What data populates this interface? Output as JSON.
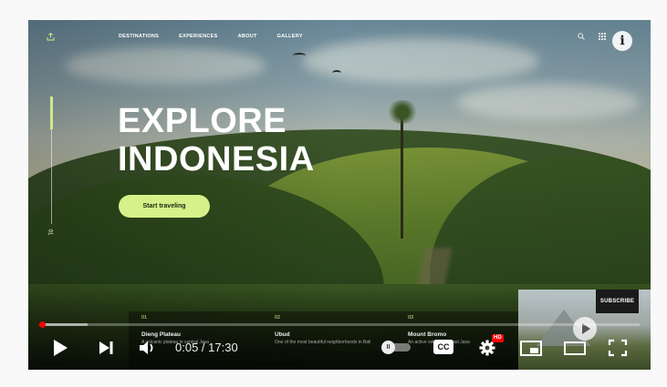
{
  "site": {
    "nav": [
      "DESTINATIONS",
      "EXPERIENCES",
      "ABOUT",
      "GALLERY"
    ],
    "hero_line1": "EXPLORE",
    "hero_line2": "INDONESIA",
    "cta_label": "Start traveling",
    "rail_number": "01",
    "cards": [
      {
        "num": "01",
        "title": "Dieng Plateau",
        "desc": "A volcanic plateau in central Java"
      },
      {
        "num": "02",
        "title": "Ubud",
        "desc": "One of the most beautiful neighborhoods in Bali"
      },
      {
        "num": "03",
        "title": "Mount Bromo",
        "desc": "An active volcano in East Java"
      }
    ]
  },
  "player": {
    "info_glyph": "i",
    "subscribe_label": "SUBSCRIBE",
    "time_display": "0:05 / 17:30",
    "cc_label": "CC",
    "hd_badge": "HD",
    "autoplay_glyph": "II",
    "progress_played_fraction": 0.005,
    "progress_loaded_fraction": 0.08,
    "accent_color": "#ff0000",
    "icons": [
      "upload-icon",
      "search-icon",
      "grid-icon",
      "info-icon",
      "play-icon",
      "next-icon",
      "volume-icon",
      "autoplay-toggle",
      "cc-icon",
      "settings-gear-icon",
      "miniplayer-icon",
      "theater-mode-icon",
      "fullscreen-icon"
    ]
  }
}
